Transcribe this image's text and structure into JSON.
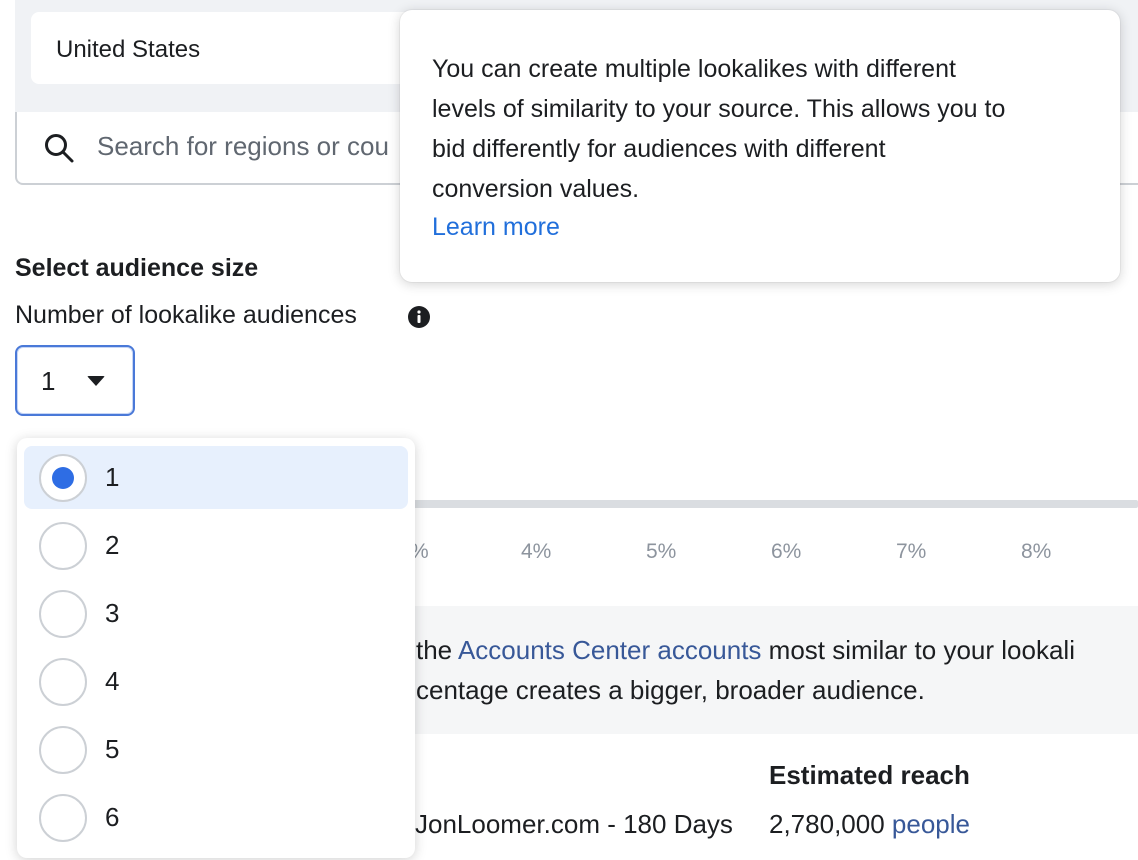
{
  "location": {
    "selected": "United States"
  },
  "search": {
    "placeholder": "Search for regions or cou"
  },
  "audience_size": {
    "title": "Select audience size",
    "count_label": "Number of lookalike audiences",
    "selected_count": "1",
    "options": [
      "1",
      "2",
      "3",
      "4",
      "5",
      "6"
    ]
  },
  "slider": {
    "ticks": [
      "%",
      "4%",
      "5%",
      "6%",
      "7%",
      "8%"
    ]
  },
  "description": {
    "line1_prefix": "the ",
    "line1_link": "Accounts Center accounts",
    "line1_suffix": " most similar to your lookali",
    "line2": "centage creates a bigger, broader audience."
  },
  "reach": {
    "heading": "Estimated reach",
    "source_name": "JonLoomer.com - 180 Days",
    "value": "2,780,000",
    "unit_link": "people"
  },
  "tooltip": {
    "lines": [
      "You can create multiple lookalikes with different",
      "levels of similarity to your source. This allows you to",
      "bid differently for audiences with different",
      "conversion values."
    ],
    "link": "Learn more"
  },
  "colors": {
    "accent": "#2e6de4",
    "link": "#385898",
    "tooltip_link": "#216fdb"
  }
}
